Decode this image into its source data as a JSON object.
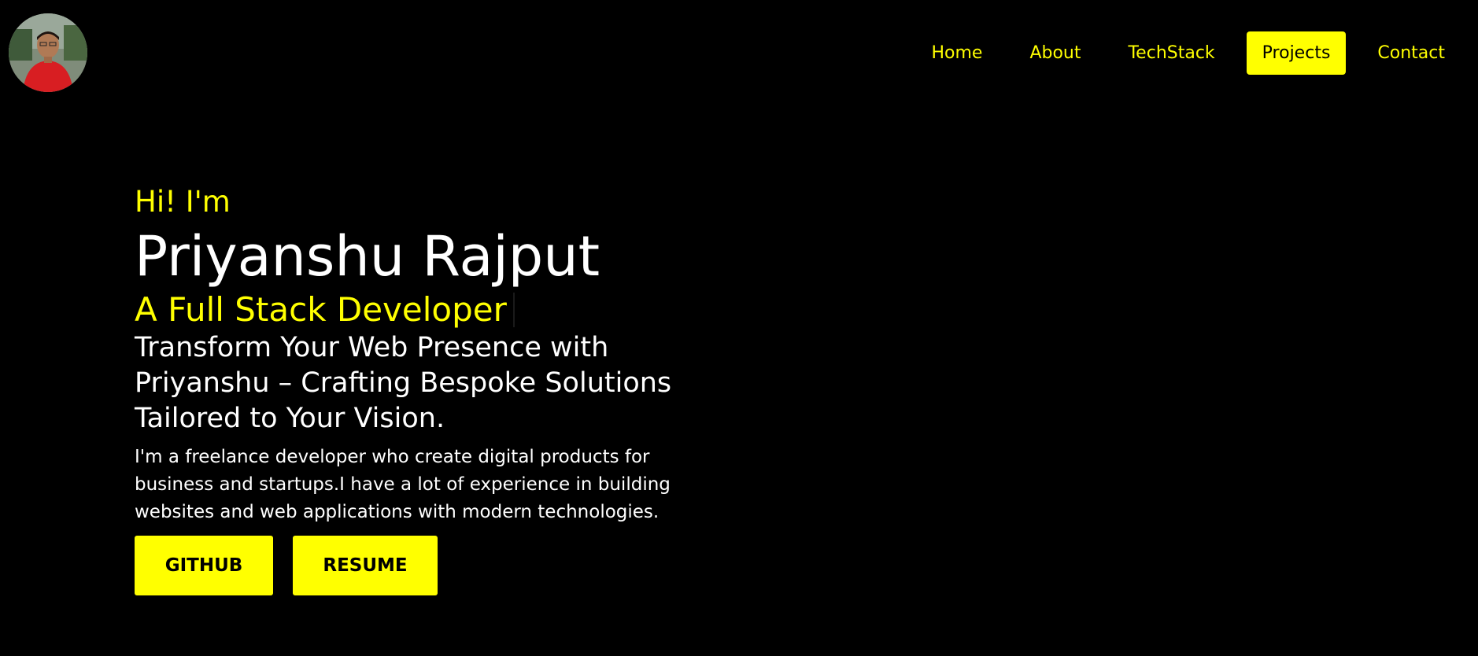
{
  "header": {
    "nav": [
      {
        "label": "Home"
      },
      {
        "label": "About"
      },
      {
        "label": "TechStack"
      },
      {
        "label": "Projects",
        "active": true
      },
      {
        "label": "Contact"
      }
    ]
  },
  "hero": {
    "greeting": "Hi! I'm",
    "name": "Priyanshu Rajput",
    "role": "A Full Stack Developer",
    "tagline": "Transform Your Web Presence with Priyanshu – Crafting Bespoke Solutions Tailored to Your Vision.",
    "description": "I'm a freelance developer who create digital products for business and startups.I have a lot of experience in building websites and web applications with modern technologies.",
    "buttons": {
      "github": "GITHUB",
      "resume": "RESUME"
    }
  },
  "colors": {
    "background": "#000000",
    "accent": "#ffff00",
    "text": "#ffffff"
  }
}
